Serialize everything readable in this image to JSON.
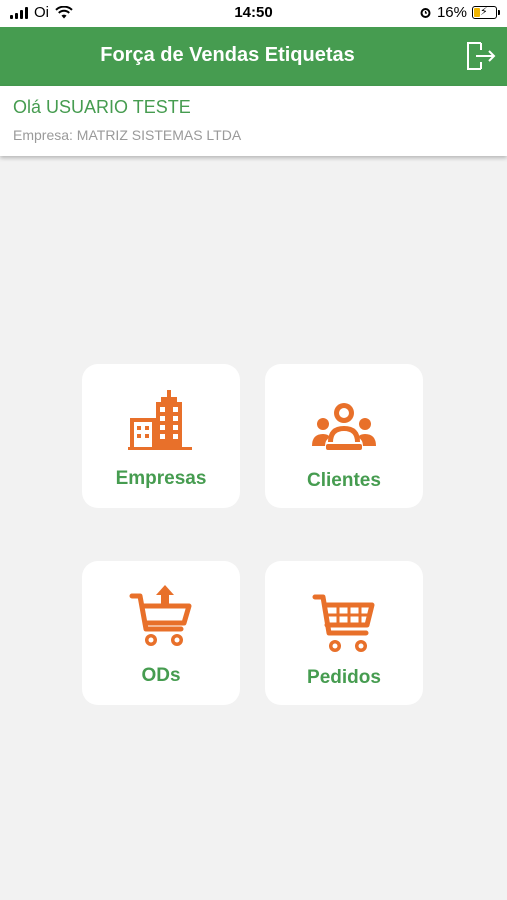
{
  "status_bar": {
    "carrier": "Oi",
    "time": "14:50",
    "battery_percent": "16%"
  },
  "header": {
    "title": "Força de Vendas Etiquetas",
    "exit_icon": "logout-icon"
  },
  "user": {
    "greeting": "Olá USUARIO TESTE",
    "company": "Empresa: MATRIZ SISTEMAS LTDA"
  },
  "menu": [
    {
      "label": "Empresas",
      "icon": "building-icon"
    },
    {
      "label": "Clientes",
      "icon": "people-icon"
    },
    {
      "label": "ODs",
      "icon": "cart-upload-icon"
    },
    {
      "label": "Pedidos",
      "icon": "shopping-cart-icon"
    }
  ],
  "colors": {
    "primary_green": "#469c50",
    "icon_orange": "#e8702a",
    "background": "#f2f2f2"
  }
}
